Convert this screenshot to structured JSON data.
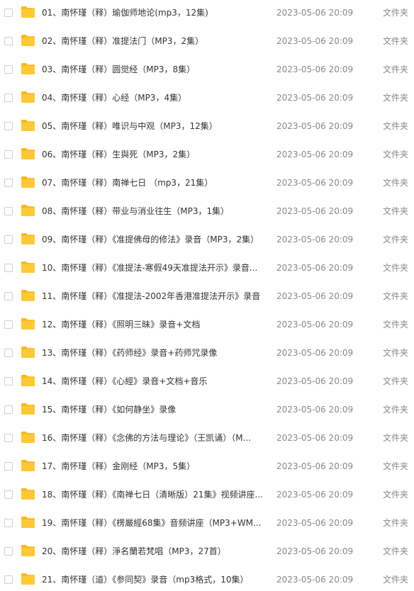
{
  "icons": {
    "folder": "folder-icon",
    "folder_color": "#ffc933",
    "folder_tab_color": "#ffb619"
  },
  "files": [
    {
      "name": "01、南怀瑾（释）瑜伽师地论(mp3，12集)",
      "modified": "2023-05-06 20:09",
      "type": "文件夹"
    },
    {
      "name": "02、南怀瑾（释）准提法门（MP3，2集）",
      "modified": "2023-05-06 20:09",
      "type": "文件夹"
    },
    {
      "name": "03、南怀瑾（释）圆觉经（MP3，8集）",
      "modified": "2023-05-06 20:09",
      "type": "文件夹"
    },
    {
      "name": "04、南怀瑾（释）心经（MP3，4集）",
      "modified": "2023-05-06 20:09",
      "type": "文件夹"
    },
    {
      "name": "05、南怀瑾（释）唯识与中观（MP3，12集）",
      "modified": "2023-05-06 20:09",
      "type": "文件夹"
    },
    {
      "name": "06、南怀瑾（释）生與死（MP3，2集）",
      "modified": "2023-05-06 20:09",
      "type": "文件夹"
    },
    {
      "name": "07、南怀瑾（释）南禅七日 （mp3，21集）",
      "modified": "2023-05-06 20:09",
      "type": "文件夹"
    },
    {
      "name": "08、南怀瑾（释）带业与消业往生（MP3，1集）",
      "modified": "2023-05-06 20:09",
      "type": "文件夹"
    },
    {
      "name": "09、南怀瑾（释）《准提佛母的修法》录音（MP3，2集）",
      "modified": "2023-05-06 20:09",
      "type": "文件夹"
    },
    {
      "name": "10、南怀瑾（释）《准提法-寒假49天准提法开示》录音...",
      "modified": "2023-05-06 20:09",
      "type": "文件夹"
    },
    {
      "name": "11、南怀瑾（释）《准提法-2002年香港准提法开示》录音",
      "modified": "2023-05-06 20:09",
      "type": "文件夹"
    },
    {
      "name": "12、南怀瑾（释）《照明三昧》录音+文档",
      "modified": "2023-05-06 20:09",
      "type": "文件夹"
    },
    {
      "name": "13、南怀瑾（释）《药师经》录音+药师咒录像",
      "modified": "2023-05-06 20:09",
      "type": "文件夹"
    },
    {
      "name": "14、南怀瑾（释）《心經》录音+文档+音乐",
      "modified": "2023-05-06 20:09",
      "type": "文件夹"
    },
    {
      "name": "15、南怀瑾（释）《如何静坐》录像",
      "modified": "2023-05-06 20:09",
      "type": "文件夹"
    },
    {
      "name": "16、南怀瑾（释）《念佛的方法与理论》（王凯诵）（M...",
      "modified": "2023-05-06 20:09",
      "type": "文件夹"
    },
    {
      "name": "17、南怀瑾（释）金刚经（MP3，5集）",
      "modified": "2023-05-06 20:09",
      "type": "文件夹"
    },
    {
      "name": "18、南怀瑾（释）《南禅七日（清晰版）21集》视频讲座...",
      "modified": "2023-05-06 20:09",
      "type": "文件夹"
    },
    {
      "name": "19、南怀瑾（释）《楞嚴經68集》音频讲座（MP3+WM...",
      "modified": "2023-05-06 20:09",
      "type": "文件夹"
    },
    {
      "name": "20、南怀瑾（释）淨名蘭若梵唱（MP3，27首）",
      "modified": "2023-05-06 20:09",
      "type": "文件夹"
    },
    {
      "name": "21、南怀瑾（道）《参同契》录音（mp3格式，10集）",
      "modified": "2023-05-06 20:09",
      "type": "文件夹"
    }
  ]
}
